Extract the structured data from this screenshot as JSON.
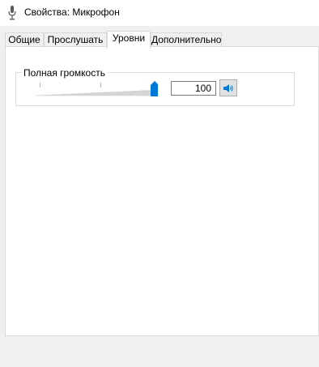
{
  "window": {
    "title": "Свойства: Микрофон",
    "icon": "microphone-icon"
  },
  "tabs": [
    {
      "label": "Общие",
      "active": false
    },
    {
      "label": "Прослушать",
      "active": false
    },
    {
      "label": "Уровни",
      "active": true
    },
    {
      "label": "Дополнительно",
      "active": false
    }
  ],
  "levels": {
    "group_label": "Полная громкость",
    "volume_value": "100",
    "volume_level": 1.0,
    "mute_icon": "speaker-icon"
  },
  "colors": {
    "accent": "#0078d7",
    "slider_track": "#e5e5e5"
  }
}
